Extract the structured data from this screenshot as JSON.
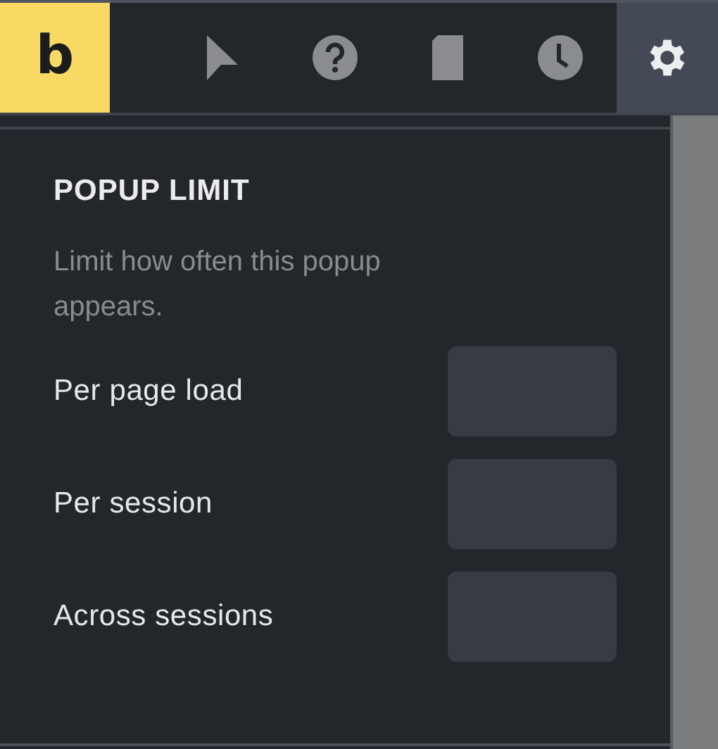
{
  "logo": {
    "text": "b"
  },
  "toolbar": [
    {
      "kind": "pointer",
      "selected": false
    },
    {
      "kind": "help",
      "selected": false
    },
    {
      "kind": "page",
      "selected": false
    },
    {
      "kind": "history",
      "selected": false
    },
    {
      "kind": "settings",
      "selected": true
    }
  ],
  "section": {
    "title": "POPUP LIMIT",
    "description": "Limit how often this popup appears.",
    "fields": [
      {
        "label": "Per page load"
      },
      {
        "label": "Per session"
      },
      {
        "label": "Across sessions"
      }
    ]
  }
}
